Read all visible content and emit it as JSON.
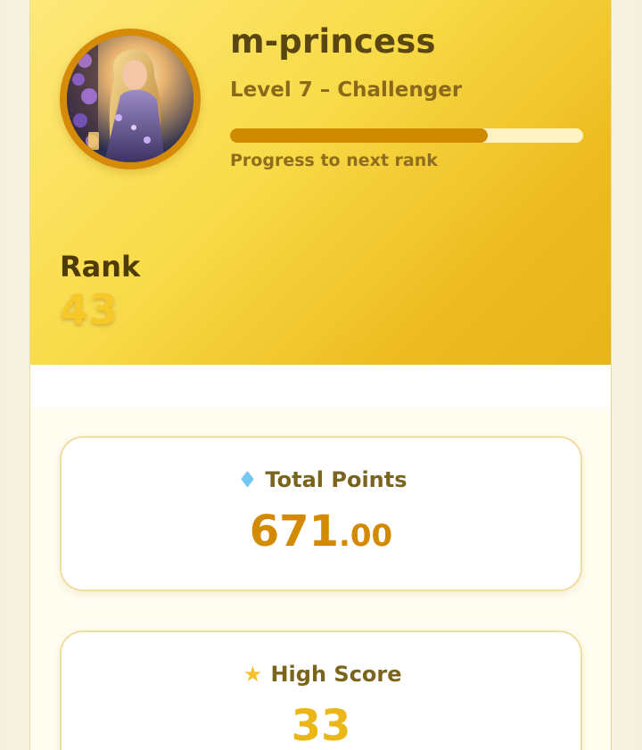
{
  "profile": {
    "username": "m-princess",
    "level_text": "Level 7 – Challenger",
    "progress_label": "Progress to next rank",
    "progress_fraction": 0.73
  },
  "rank": {
    "label": "Rank",
    "value": "43"
  },
  "stats": {
    "total_points": {
      "label": "Total Points",
      "icon": "diamond-icon",
      "integer": "671",
      "decimal": ".00"
    },
    "high_score": {
      "label": "High Score",
      "icon": "star-icon",
      "value": "33"
    }
  },
  "colors": {
    "gold_dark": "#d08a00",
    "gold_light": "#f7c928",
    "brown_text": "#5a4610",
    "card_border": "#efdea4"
  }
}
